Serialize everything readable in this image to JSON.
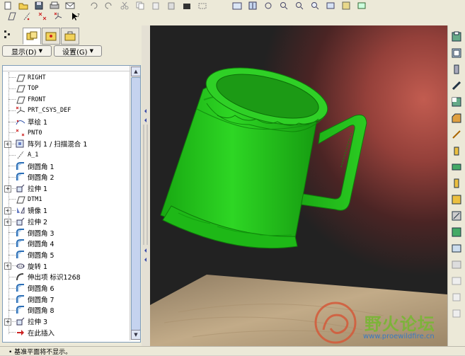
{
  "panel": {
    "display_menu": "显示(D)",
    "settings_menu": "设置(G)"
  },
  "tree": {
    "items": [
      {
        "label": "RIGHT",
        "icon": "datum-plane-icon"
      },
      {
        "label": "TOP",
        "icon": "datum-plane-icon"
      },
      {
        "label": "FRONT",
        "icon": "datum-plane-icon"
      },
      {
        "label": "PRT_CSYS_DEF",
        "icon": "csys-icon"
      },
      {
        "label": "草绘 1",
        "icon": "sketch-icon"
      },
      {
        "label": "PNT0",
        "icon": "datum-point-icon"
      },
      {
        "label": "阵列 1 / 扫描混合 1",
        "icon": "pattern-icon",
        "expandable": true
      },
      {
        "label": "A_1",
        "icon": "axis-icon"
      },
      {
        "label": "倒圆角 1",
        "icon": "round-icon"
      },
      {
        "label": "倒圆角 2",
        "icon": "round-icon"
      },
      {
        "label": "拉伸 1",
        "icon": "extrude-icon",
        "expandable": true
      },
      {
        "label": "DTM1",
        "icon": "datum-plane-icon"
      },
      {
        "label": "镜像 1",
        "icon": "mirror-icon",
        "expandable": true
      },
      {
        "label": "拉伸 2",
        "icon": "extrude-icon",
        "expandable": true
      },
      {
        "label": "倒圆角 3",
        "icon": "round-icon"
      },
      {
        "label": "倒圆角 4",
        "icon": "round-icon"
      },
      {
        "label": "倒圆角 5",
        "icon": "round-icon"
      },
      {
        "label": "旋转 1",
        "icon": "revolve-icon",
        "expandable": true
      },
      {
        "label": "伸出项 标识1268",
        "icon": "protrusion-icon"
      },
      {
        "label": "倒圆角 6",
        "icon": "round-icon"
      },
      {
        "label": "倒圆角 7",
        "icon": "round-icon"
      },
      {
        "label": "倒圆角 8",
        "icon": "round-icon"
      },
      {
        "label": "拉伸 3",
        "icon": "extrude-icon",
        "expandable": true
      },
      {
        "label": "在此插入",
        "icon": "insert-arrow-icon"
      }
    ]
  },
  "status": {
    "message": "• 基准平面将不显示。"
  },
  "watermark": {
    "title": "野火论坛",
    "url": "www.proewildfire.cn"
  },
  "colors": {
    "model_green": "#22c21a",
    "background_red": "#b04a44",
    "background_dark": "#222222",
    "floor_wood": "#b59e7e",
    "tree_selection_blue": "#c5d3ef"
  }
}
